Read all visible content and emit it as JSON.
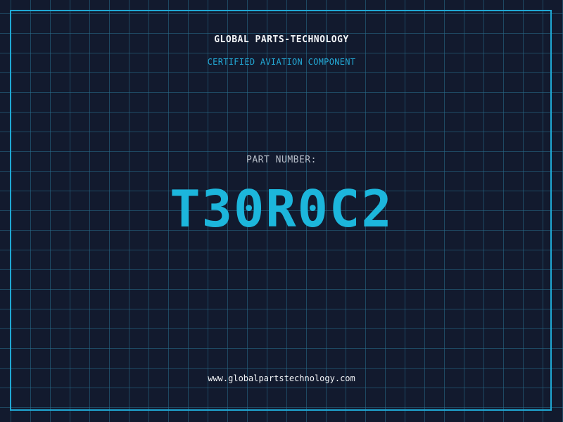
{
  "header": {
    "company_name": "GLOBAL PARTS-TECHNOLOGY",
    "tagline": "CERTIFIED AVIATION COMPONENT"
  },
  "part": {
    "label": "PART NUMBER:",
    "number": "T30R0C2"
  },
  "footer": {
    "website": "www.globalpartstechnology.com"
  },
  "colors": {
    "background": "#121a2e",
    "grid": "#286e8c",
    "frame": "#1fa8d4",
    "accent": "#1cb6dc",
    "text": "#f2f4f7",
    "muted": "#b6bdc8"
  }
}
